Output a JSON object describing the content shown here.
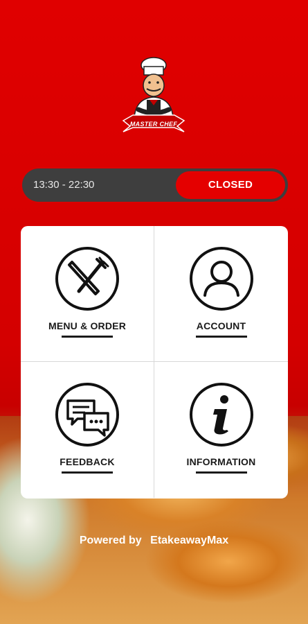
{
  "logo": {
    "text": "MASTER CHEF",
    "icon": "chef-logo-icon"
  },
  "hours": {
    "range": "13:30 - 22:30",
    "status": "CLOSED"
  },
  "tiles": [
    {
      "label": "MENU & ORDER",
      "icon": "fork-knife-icon"
    },
    {
      "label": "ACCOUNT",
      "icon": "user-icon"
    },
    {
      "label": "FEEDBACK",
      "icon": "chat-bubbles-icon"
    },
    {
      "label": "INFORMATION",
      "icon": "info-icon"
    }
  ],
  "footer": {
    "powered_by": "Powered by",
    "brand": "EtakeawayMax"
  },
  "colors": {
    "primary": "#e00000",
    "bar": "#3e3e3e",
    "card": "#ffffff"
  }
}
